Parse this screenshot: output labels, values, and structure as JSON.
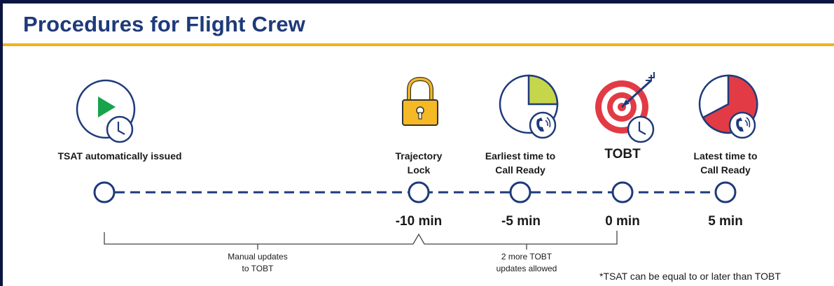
{
  "header": {
    "title": "Procedures for Flight Crew"
  },
  "timeline": {
    "events": [
      {
        "label": "TSAT automatically issued",
        "icon": "play-clock-icon"
      },
      {
        "label_line1": "Trajectory",
        "label_line2": "Lock",
        "time": "-10 min",
        "icon": "padlock-icon"
      },
      {
        "label_line1": "Earliest time to",
        "label_line2": "Call Ready",
        "time": "-5 min",
        "icon": "clock-phone-icon"
      },
      {
        "label": "TOBT",
        "time": "0 min",
        "icon": "target-clock-icon"
      },
      {
        "label_line1": "Latest time to",
        "label_line2": "Call Ready",
        "time": "5 min",
        "icon": "clock-phone-icon"
      }
    ]
  },
  "brackets": {
    "manual": {
      "line1": "Manual updates",
      "line2": "to TOBT"
    },
    "more": {
      "line1": "2 more TOBT",
      "line2": "updates allowed"
    }
  },
  "footnote": "*TSAT can be equal to or later than TOBT",
  "colors": {
    "navy": "#1e3a7a",
    "gold": "#f2b21c",
    "green": "#17a34a",
    "lime": "#c5d64a",
    "red": "#e23b45"
  }
}
